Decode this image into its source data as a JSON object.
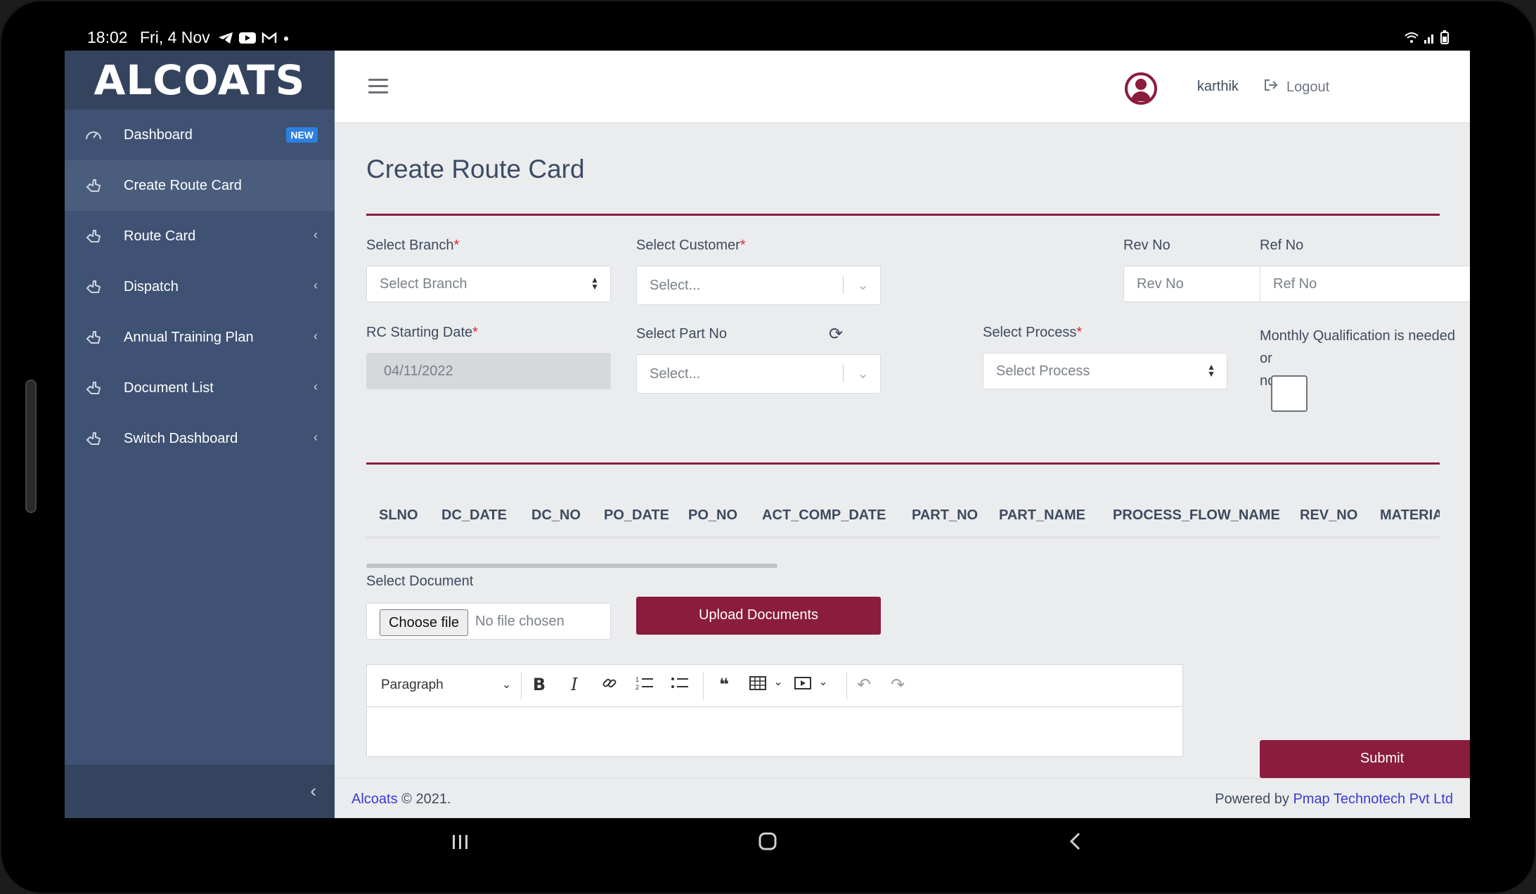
{
  "status_bar": {
    "time": "18:02",
    "date": "Fri, 4 Nov",
    "left_icons": [
      "telegram-icon",
      "youtube-icon",
      "gmail-icon",
      "dot-icon"
    ],
    "right_icons": [
      "wifi-icon",
      "signal-icon",
      "battery-icon"
    ]
  },
  "sidebar": {
    "brand": "ALCOATS",
    "items": [
      {
        "label": "Dashboard",
        "icon": "speedometer-icon",
        "badge": "NEW",
        "active": false
      },
      {
        "label": "Create Route Card",
        "icon": "hand-icon",
        "active": true
      },
      {
        "label": "Route Card",
        "icon": "hand-icon",
        "has_submenu": true
      },
      {
        "label": "Dispatch",
        "icon": "hand-icon",
        "has_submenu": true
      },
      {
        "label": "Annual Training Plan",
        "icon": "hand-icon",
        "has_submenu": true
      },
      {
        "label": "Document List",
        "icon": "hand-icon",
        "has_submenu": true
      },
      {
        "label": "Switch Dashboard",
        "icon": "hand-icon",
        "has_submenu": true
      }
    ]
  },
  "header": {
    "username": "karthik",
    "logout_label": "Logout"
  },
  "page": {
    "title": "Create Route Card"
  },
  "form": {
    "branch": {
      "label": "Select Branch",
      "required": "*",
      "value": "Select Branch"
    },
    "customer": {
      "label": "Select Customer",
      "required": "*",
      "value": "Select..."
    },
    "rev_no": {
      "label": "Rev No",
      "placeholder": "Rev No"
    },
    "ref_no": {
      "label": "Ref No",
      "placeholder": "Ref No"
    },
    "rc_start_date": {
      "label": "RC Starting Date",
      "required": "*",
      "value": "04/11/2022"
    },
    "part_no": {
      "label": "Select Part No",
      "value": "Select..."
    },
    "process": {
      "label": "Select Process",
      "required": "*",
      "value": "Select Process"
    },
    "monthly_qualification": {
      "label_line1": "Monthly Qualification is needed or",
      "label_line2": "not?",
      "checked": false
    }
  },
  "table": {
    "columns": [
      "SLNO",
      "DC_DATE",
      "DC_NO",
      "PO_DATE",
      "PO_NO",
      "ACT_COMP_DATE",
      "PART_NO",
      "PART_NAME",
      "PROCESS_FLOW_NAME",
      "REV_NO",
      "MATERIA"
    ]
  },
  "document": {
    "label": "Select Document",
    "choose_file_label": "Choose file",
    "file_status": "No file chosen",
    "upload_label": "Upload Documents"
  },
  "editor": {
    "paragraph_label": "Paragraph"
  },
  "submit_label": "Submit",
  "footer": {
    "brand_link": "Alcoats",
    "copyright": "© 2021.",
    "powered_by": "Powered by",
    "company_link": "Pmap Technotech Pvt Ltd"
  },
  "colors": {
    "sidebar": "#3f5273",
    "accent": "#8a1c3d",
    "badge": "#2d7fe0",
    "link": "#3b3bd0"
  }
}
